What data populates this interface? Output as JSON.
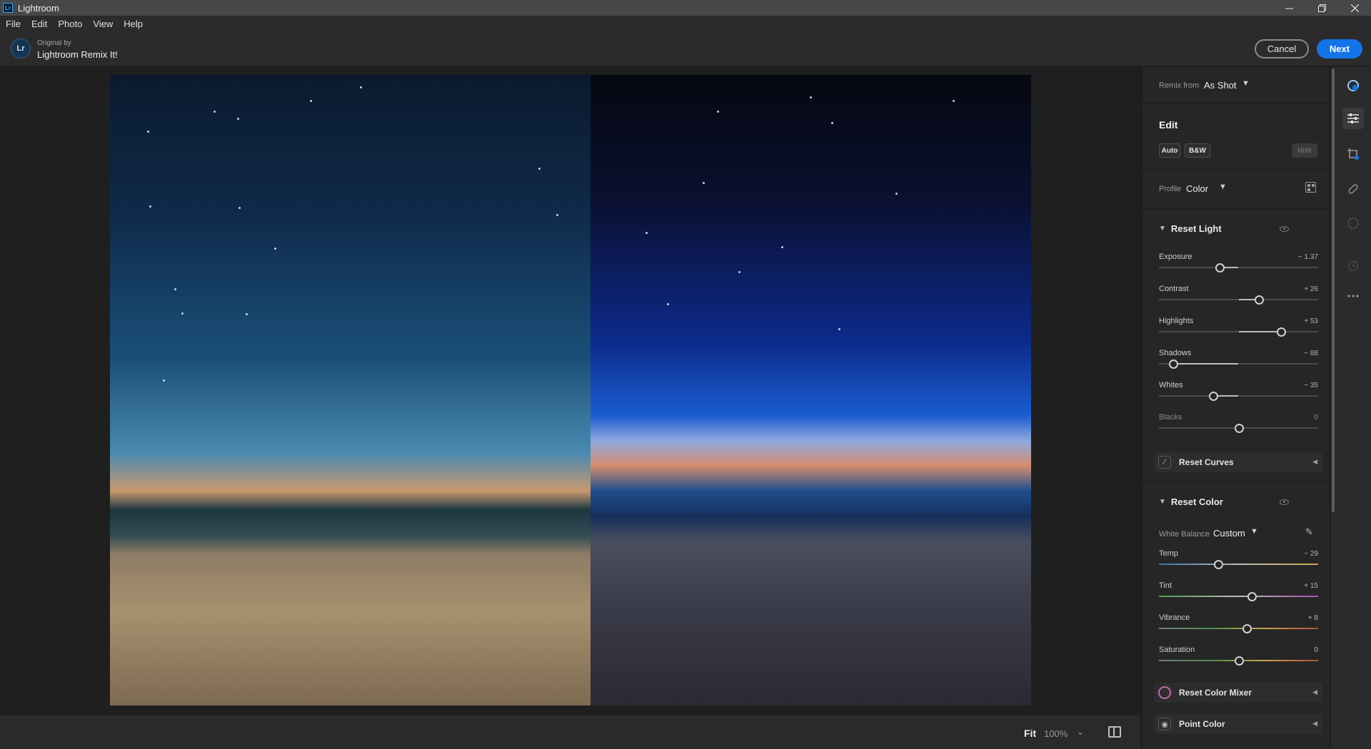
{
  "window": {
    "app_badge": "Lr",
    "title": "Lightroom"
  },
  "menu": [
    "File",
    "Edit",
    "Photo",
    "View",
    "Help"
  ],
  "header": {
    "avatar_initials": "Lr",
    "original_by_label": "Original by",
    "author": "Lightroom Remix It!",
    "cancel_label": "Cancel",
    "next_label": "Next"
  },
  "footer": {
    "fit_label": "Fit",
    "zoom_label": "100%"
  },
  "panel": {
    "remix_from_label": "Remix from",
    "remix_from_value": "As Shot",
    "edit_title": "Edit",
    "auto_label": "Auto",
    "bw_label": "B&W",
    "hdr_label": "HDR",
    "profile_label": "Profile",
    "profile_value": "Color",
    "light": {
      "title": "Reset Light",
      "sliders": [
        {
          "name": "Exposure",
          "value": "− 1.37",
          "position": 0.38
        },
        {
          "name": "Contrast",
          "value": "+ 26",
          "position": 0.63
        },
        {
          "name": "Highlights",
          "value": "+ 53",
          "position": 0.765
        },
        {
          "name": "Shadows",
          "value": "− 88",
          "position": 0.09
        },
        {
          "name": "Whites",
          "value": "− 35",
          "position": 0.34
        },
        {
          "name": "Blacks",
          "value": "0",
          "position": 0.5
        }
      ]
    },
    "curves_label": "Reset Curves",
    "color": {
      "title": "Reset Color",
      "white_balance_label": "White Balance",
      "white_balance_value": "Custom",
      "sliders": [
        {
          "name": "Temp",
          "value": "− 29",
          "position": 0.37
        },
        {
          "name": "Tint",
          "value": "+ 15",
          "position": 0.585
        },
        {
          "name": "Vibrance",
          "value": "+ 8",
          "position": 0.55
        },
        {
          "name": "Saturation",
          "value": "0",
          "position": 0.5
        }
      ]
    },
    "color_mixer_label": "Reset Color Mixer",
    "point_color_label": "Point Color"
  },
  "tools": [
    "remix-icon",
    "edit-sliders-icon",
    "crop-icon",
    "healing-icon",
    "masking-icon",
    "versions-icon",
    "more-icon"
  ],
  "colors": {
    "accent": "#1473e6",
    "panel_bg": "#262626",
    "app_bg": "#1e1e1e"
  }
}
